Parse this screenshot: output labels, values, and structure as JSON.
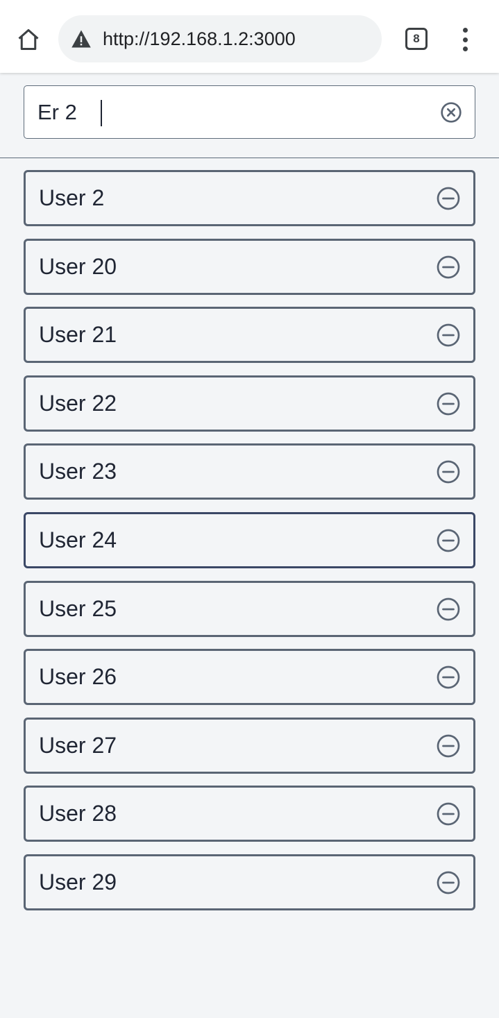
{
  "browser": {
    "url": "http://192.168.1.2:3000",
    "tab_count": "8"
  },
  "search": {
    "value": "Er 2"
  },
  "users": [
    {
      "label": "User 2"
    },
    {
      "label": "User 20"
    },
    {
      "label": "User 21"
    },
    {
      "label": "User 22"
    },
    {
      "label": "User 23"
    },
    {
      "label": "User 24",
      "focused": true
    },
    {
      "label": "User 25"
    },
    {
      "label": "User 26"
    },
    {
      "label": "User 27"
    },
    {
      "label": "User 28"
    },
    {
      "label": "User 29"
    }
  ],
  "colors": {
    "background": "#f3f5f7",
    "border": "#5a6574",
    "focus_border": "#3b4866",
    "text": "#1f2533"
  },
  "icons": {
    "home": "home-icon",
    "warning": "warning-icon",
    "clear": "clear-circle-x-icon",
    "remove": "minus-circle-icon",
    "menu": "more-vert-icon"
  }
}
